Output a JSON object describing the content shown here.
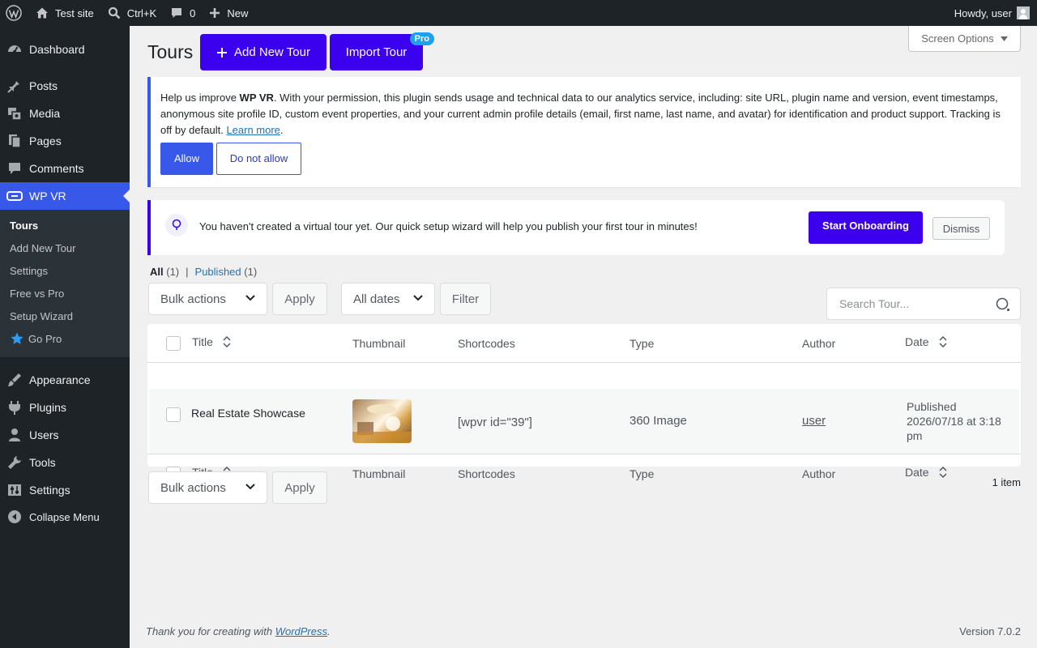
{
  "adminbar": {
    "site_name": "Test site",
    "search_shortcut": "Ctrl+K",
    "comments_count": "0",
    "new_label": "New",
    "howdy": "Howdy, user"
  },
  "sidebar": {
    "items": [
      {
        "label": "Dashboard",
        "icon": "dashboard-icon"
      },
      {
        "label": "Posts",
        "icon": "pin-icon"
      },
      {
        "label": "Media",
        "icon": "media-icon"
      },
      {
        "label": "Pages",
        "icon": "pages-icon"
      },
      {
        "label": "Comments",
        "icon": "comment-icon"
      },
      {
        "label": "WP VR",
        "icon": "vr-headset-icon"
      },
      {
        "label": "Appearance",
        "icon": "brush-icon"
      },
      {
        "label": "Plugins",
        "icon": "plugin-icon"
      },
      {
        "label": "Users",
        "icon": "user-icon"
      },
      {
        "label": "Tools",
        "icon": "wrench-icon"
      },
      {
        "label": "Settings",
        "icon": "settings-icon"
      },
      {
        "label": "Collapse Menu",
        "icon": "collapse-icon"
      }
    ],
    "submenu": [
      "Tours",
      "Add New Tour",
      "Settings",
      "Free vs Pro",
      "Setup Wizard",
      "Go Pro"
    ]
  },
  "header": {
    "title": "Tours",
    "add_new_label": "Add New Tour",
    "import_label": "Import Tour",
    "pro_badge": "Pro",
    "screen_options": "Screen Options"
  },
  "tracking_notice": {
    "prefix": "Help us improve ",
    "plugin_name": "WP VR",
    "body": ". With your permission, this plugin sends usage and technical data to our analytics service, including: site URL, plugin name and version, event timestamps, anonymous site profile ID, custom event properties, and your current admin profile details (email, first name, last name, and avatar) for identification and product support. Tracking is off by default. ",
    "learn_more": "Learn more",
    "period": ".",
    "allow_label": "Allow",
    "deny_label": "Do not allow"
  },
  "onboarding": {
    "message": "You haven't created a virtual tour yet. Our quick setup wizard will help you publish your first tour in minutes!",
    "start_label": "Start Onboarding",
    "dismiss_label": "Dismiss"
  },
  "filters": {
    "all_label": "All",
    "all_count": "(1)",
    "separator": "|",
    "published_label": "Published",
    "published_count": "(1)",
    "bulk_actions": "Bulk actions",
    "apply": "Apply",
    "all_dates": "All dates",
    "filter": "Filter",
    "search_placeholder": "Search Tour..."
  },
  "table": {
    "columns": [
      "Title",
      "Thumbnail",
      "Shortcodes",
      "Type",
      "Author",
      "Date"
    ],
    "rows": [
      {
        "title": "Real Estate Showcase",
        "shortcode": "[wpvr id=\"39\"]",
        "type": "360 Image",
        "author": "user",
        "status": "Published",
        "date": "2026/07/18 at 3:18",
        "time_suffix": "pm"
      }
    ],
    "item_count": "1 item"
  },
  "footer": {
    "thanks": "Thank you for creating with ",
    "wp_link": "WordPress",
    "period": ".",
    "version": "Version 7.0.2"
  },
  "colors": {
    "vr_purple": "#3b00ed",
    "wp_blue": "#3858e9",
    "admin_dark": "#1d2327"
  }
}
